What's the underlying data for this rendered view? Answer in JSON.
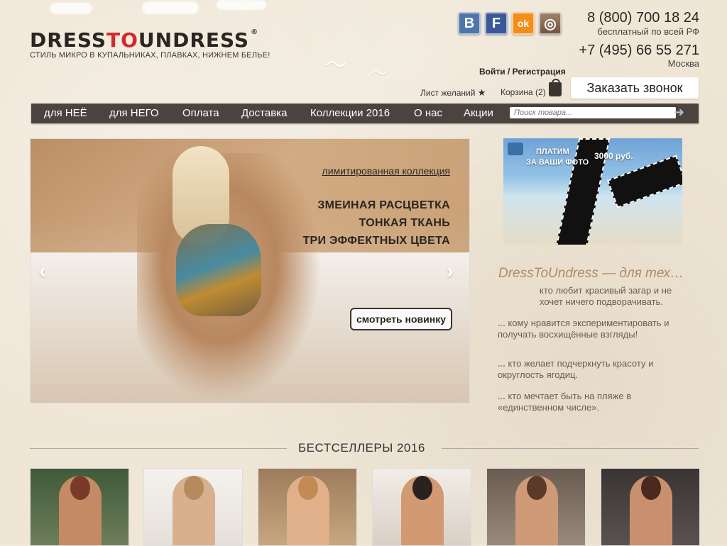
{
  "brand": {
    "logo_part1": "DRESS",
    "logo_part2": "TO",
    "logo_part3": "UNDRESS",
    "trademark": "®",
    "tagline": "СТИЛЬ МИКРО В КУПАЛЬНИКАХ, ПЛАВКАХ, НИЖНЕМ БЕЛЬЕ!"
  },
  "social": {
    "vk": "В",
    "fb": "F",
    "ok": "ok",
    "ig": "◎"
  },
  "contacts": {
    "phone1": "8 (800) 700 18 24",
    "phone1_note": "бесплатный по всей РФ",
    "phone2": "+7 (495) 66 55 271",
    "phone2_note": "Москва"
  },
  "account": {
    "login": "Войти / Регистрация",
    "wishlist": "Лист желаний",
    "wishlist_star": "★",
    "cart": "Корзина (2)",
    "callback": "Заказать звонок"
  },
  "nav": {
    "items": [
      "для НЕЁ",
      "для НЕГО",
      "Оплата",
      "Доставка",
      "Коллекции 2016",
      "О нас",
      "Акции"
    ],
    "search_placeholder": "Поиск товара...",
    "search_arrow": "➜"
  },
  "hero": {
    "subtitle": "лимитированная коллекция",
    "line1": "ЗМЕИНАЯ РАСЦВЕТКА",
    "line2": "ТОНКАЯ ТКАНЬ",
    "line3": "ТРИ ЭФФЕКТНЫХ ЦВЕТА",
    "button": "смотреть новинку",
    "prev": "‹",
    "next": "›"
  },
  "promo": {
    "text_line1": "ПЛАТИМ",
    "text_line2": "ЗА ВАШИ ФОТО",
    "price": "3000 руб."
  },
  "intro": {
    "heading": "DressToUndress — для тех…",
    "p1": "кто любит красивый загар и не хочет ничего подворачивать.",
    "p2_lead": "...",
    "p2": " кому нравится экспериментировать и получать восхищённые взгляды!",
    "p3_lead": "...",
    "p3": " кто желает подчеркнуть красоту и округлость ягодиц.",
    "p4_lead": "...",
    "p4": " кто мечтает быть на пляже в «единственном числе»."
  },
  "bestsellers": {
    "title": "БЕСТСЕЛЛЕРЫ 2016"
  }
}
